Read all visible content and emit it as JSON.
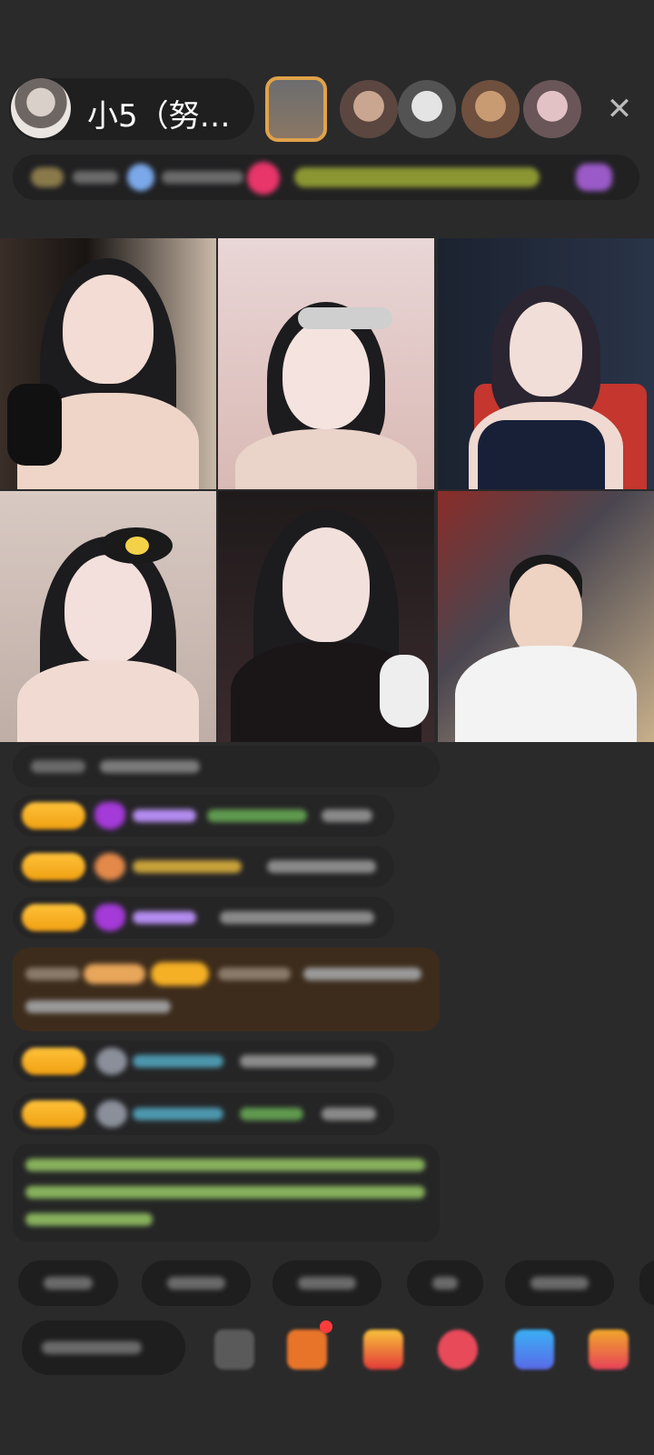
{
  "header": {
    "host_name": "小5（努…",
    "close_icon": "close-icon"
  },
  "colors": {
    "background": "#2a2a2b",
    "level_badge": "#f5b025",
    "username_purple": "#b48cf0",
    "username_cyan": "#5ec8e8",
    "system_green": "#9fd46a"
  },
  "grid": {
    "tiles": [
      "streamer-1",
      "streamer-2",
      "streamer-3",
      "streamer-4",
      "streamer-5",
      "streamer-6"
    ]
  }
}
